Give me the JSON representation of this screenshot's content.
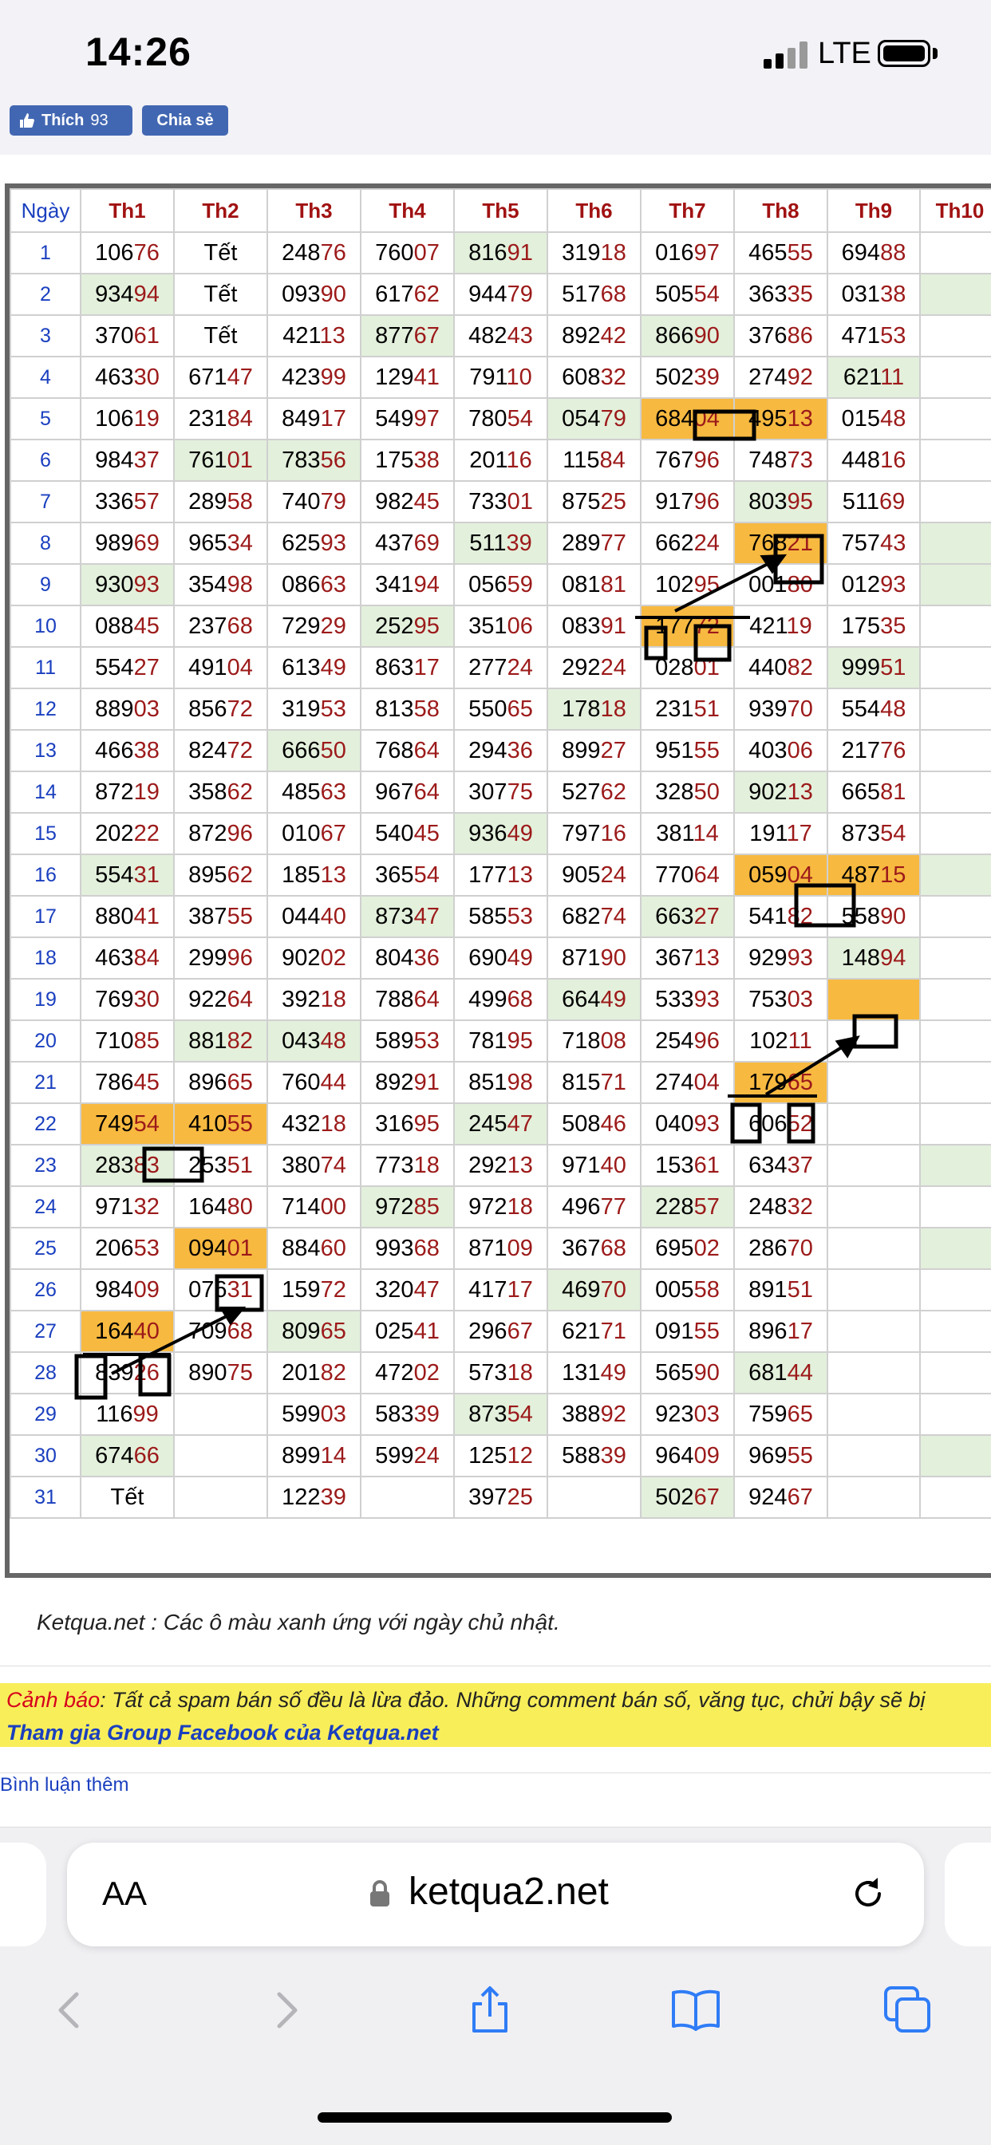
{
  "status_bar": {
    "time": "14:26",
    "network": "LTE"
  },
  "share": {
    "like_label": "Thích",
    "like_count": "93",
    "share_label": "Chia sẻ"
  },
  "table": {
    "headers": [
      "Ngày",
      "Th1",
      "Th2",
      "Th3",
      "Th4",
      "Th5",
      "Th6",
      "Th7",
      "Th8",
      "Th9",
      "Th10"
    ],
    "rows": [
      {
        "day": "1",
        "cells": [
          "10676",
          "Tết",
          "24876",
          "76007",
          "81691",
          "31918",
          "01697",
          "46555",
          "69488",
          ""
        ]
      },
      {
        "day": "2",
        "cells": [
          "93494",
          "Tết",
          "09390",
          "61762",
          "94479",
          "51768",
          "50554",
          "36335",
          "03138",
          ""
        ]
      },
      {
        "day": "3",
        "cells": [
          "37061",
          "Tết",
          "42113",
          "87767",
          "48243",
          "89242",
          "86690",
          "37686",
          "47153",
          ""
        ]
      },
      {
        "day": "4",
        "cells": [
          "46330",
          "67147",
          "42399",
          "12941",
          "79110",
          "60832",
          "50239",
          "27492",
          "62111",
          ""
        ]
      },
      {
        "day": "5",
        "cells": [
          "10619",
          "23184",
          "84917",
          "54997",
          "78054",
          "05479",
          "68404",
          "49513",
          "01548",
          ""
        ]
      },
      {
        "day": "6",
        "cells": [
          "98437",
          "76101",
          "78356",
          "17538",
          "20116",
          "11584",
          "76796",
          "74873",
          "44816",
          ""
        ]
      },
      {
        "day": "7",
        "cells": [
          "33657",
          "28958",
          "74079",
          "98245",
          "73301",
          "87525",
          "91796",
          "80395",
          "51169",
          ""
        ]
      },
      {
        "day": "8",
        "cells": [
          "98969",
          "96534",
          "62593",
          "43769",
          "51139",
          "28977",
          "66224",
          "76821",
          "75743",
          ""
        ]
      },
      {
        "day": "9",
        "cells": [
          "93093",
          "35498",
          "08663",
          "34194",
          "05659",
          "08181",
          "10295",
          "00180",
          "01293",
          ""
        ]
      },
      {
        "day": "10",
        "cells": [
          "08845",
          "23768",
          "72929",
          "25295",
          "35106",
          "08391",
          "17772",
          "42119",
          "17535",
          ""
        ]
      },
      {
        "day": "11",
        "cells": [
          "55427",
          "49104",
          "61349",
          "86317",
          "27724",
          "29224",
          "02801",
          "44082",
          "99951",
          ""
        ]
      },
      {
        "day": "12",
        "cells": [
          "88903",
          "85672",
          "31953",
          "81358",
          "55065",
          "17818",
          "23151",
          "93970",
          "55448",
          ""
        ]
      },
      {
        "day": "13",
        "cells": [
          "46638",
          "82472",
          "66650",
          "76864",
          "29436",
          "89927",
          "95155",
          "40306",
          "21776",
          ""
        ]
      },
      {
        "day": "14",
        "cells": [
          "87219",
          "35862",
          "48563",
          "96764",
          "30775",
          "52762",
          "32850",
          "90213",
          "66581",
          ""
        ]
      },
      {
        "day": "15",
        "cells": [
          "20222",
          "87296",
          "01067",
          "54045",
          "93649",
          "79716",
          "38114",
          "19117",
          "87354",
          ""
        ]
      },
      {
        "day": "16",
        "cells": [
          "55431",
          "89562",
          "18513",
          "36554",
          "17713",
          "90524",
          "77064",
          "05904",
          "48715",
          ""
        ]
      },
      {
        "day": "17",
        "cells": [
          "88041",
          "38755",
          "04440",
          "87347",
          "58553",
          "68274",
          "66327",
          "54182",
          "55890",
          ""
        ]
      },
      {
        "day": "18",
        "cells": [
          "46384",
          "29996",
          "90202",
          "80436",
          "69049",
          "87190",
          "36713",
          "92993",
          "14894",
          ""
        ]
      },
      {
        "day": "19",
        "cells": [
          "76930",
          "92264",
          "39218",
          "78864",
          "49968",
          "66449",
          "53393",
          "75303",
          "",
          ""
        ]
      },
      {
        "day": "20",
        "cells": [
          "71085",
          "88182",
          "04348",
          "58953",
          "78195",
          "71808",
          "25496",
          "10211",
          "",
          ""
        ]
      },
      {
        "day": "21",
        "cells": [
          "78645",
          "89665",
          "76044",
          "89291",
          "85198",
          "81571",
          "27404",
          "17965",
          "",
          ""
        ]
      },
      {
        "day": "22",
        "cells": [
          "74954",
          "41055",
          "43218",
          "31695",
          "24547",
          "50846",
          "04093",
          "60652",
          "",
          ""
        ]
      },
      {
        "day": "23",
        "cells": [
          "28383",
          "25351",
          "38074",
          "77318",
          "29213",
          "97140",
          "15361",
          "63437",
          "",
          ""
        ]
      },
      {
        "day": "24",
        "cells": [
          "97132",
          "16480",
          "71400",
          "97285",
          "97218",
          "49677",
          "22857",
          "24832",
          "",
          ""
        ]
      },
      {
        "day": "25",
        "cells": [
          "20653",
          "09401",
          "88460",
          "99368",
          "87109",
          "36768",
          "69502",
          "28670",
          "",
          ""
        ]
      },
      {
        "day": "26",
        "cells": [
          "98409",
          "07631",
          "15972",
          "32047",
          "41717",
          "46970",
          "00558",
          "89151",
          "",
          ""
        ]
      },
      {
        "day": "27",
        "cells": [
          "16440",
          "70968",
          "80965",
          "02541",
          "29667",
          "62171",
          "09155",
          "89617",
          "",
          ""
        ]
      },
      {
        "day": "28",
        "cells": [
          "83926",
          "89075",
          "20182",
          "47202",
          "57318",
          "13149",
          "56590",
          "68144",
          "",
          ""
        ]
      },
      {
        "day": "29",
        "cells": [
          "11699",
          "",
          "59903",
          "58339",
          "87354",
          "38892",
          "92303",
          "75965",
          "",
          ""
        ]
      },
      {
        "day": "30",
        "cells": [
          "67466",
          "",
          "89914",
          "59924",
          "12512",
          "58839",
          "96409",
          "96955",
          "",
          ""
        ]
      },
      {
        "day": "31",
        "cells": [
          "Tết",
          "",
          "12239",
          "",
          "39725",
          "",
          "50267",
          "92467",
          "",
          ""
        ]
      }
    ],
    "sunday_cells": [
      "1-5",
      "2-1",
      "2-10",
      "3-4",
      "3-7",
      "4-9",
      "5-6",
      "6-2",
      "6-3",
      "7-8",
      "8-5",
      "8-10",
      "9-1",
      "9-10",
      "10-4",
      "11-9",
      "12-6",
      "13-3",
      "14-8",
      "15-5",
      "16-1",
      "16-10",
      "17-4",
      "17-7",
      "18-9",
      "19-6",
      "20-2",
      "20-3",
      "21-8",
      "22-5",
      "23-1",
      "23-10",
      "24-4",
      "24-7",
      "25-10",
      "26-6",
      "27-3",
      "28-8",
      "29-5",
      "30-1",
      "30-10",
      "31-7"
    ],
    "highlight_cells": [
      "5-7",
      "5-8",
      "8-8",
      "10-7",
      "16-8",
      "16-9",
      "19-9",
      "21-8",
      "22-1",
      "22-2",
      "25-2",
      "27-1"
    ]
  },
  "notes": {
    "legend": "Ketqua.net : Các ô màu xanh ứng với ngày chủ nhật.",
    "warning_label": "Cảnh báo",
    "warning_text": ": Tất cả spam bán số đều là lừa đảo. Những comment bán số, văng tục, chửi bậy sẽ bị",
    "group_link": "Tham gia Group Facebook của Ketqua.net",
    "more_comments": "Bình luận thêm"
  },
  "browser": {
    "text_size_label": "AA",
    "url": "ketqua2.net"
  },
  "colors": {
    "sunday": "#e3f0dc",
    "highlight": "#f7b940",
    "header_red": "#a11212",
    "day_blue": "#1a3fbf",
    "fb_blue": "#4267b2",
    "warning_bg": "#f8ee5a"
  }
}
